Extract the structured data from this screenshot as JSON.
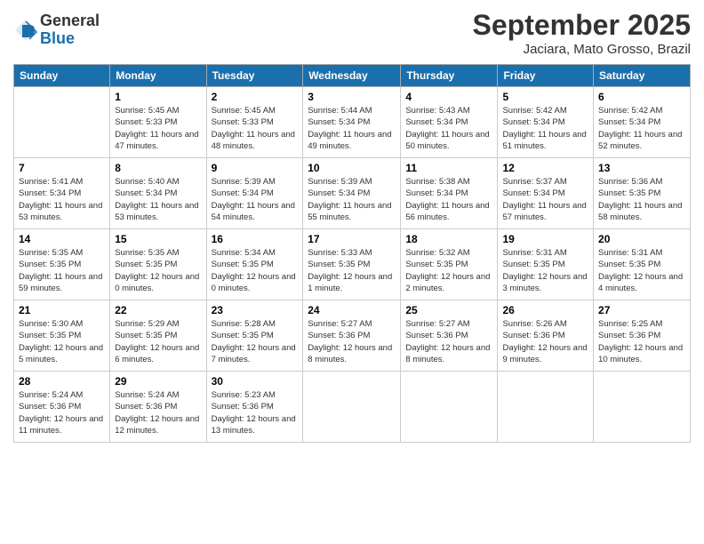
{
  "header": {
    "logo_general": "General",
    "logo_blue": "Blue",
    "month_title": "September 2025",
    "subtitle": "Jaciara, Mato Grosso, Brazil"
  },
  "days_of_week": [
    "Sunday",
    "Monday",
    "Tuesday",
    "Wednesday",
    "Thursday",
    "Friday",
    "Saturday"
  ],
  "weeks": [
    [
      {
        "day": "",
        "empty": true
      },
      {
        "day": "1",
        "sunrise": "Sunrise: 5:45 AM",
        "sunset": "Sunset: 5:33 PM",
        "daylight": "Daylight: 11 hours and 47 minutes."
      },
      {
        "day": "2",
        "sunrise": "Sunrise: 5:45 AM",
        "sunset": "Sunset: 5:33 PM",
        "daylight": "Daylight: 11 hours and 48 minutes."
      },
      {
        "day": "3",
        "sunrise": "Sunrise: 5:44 AM",
        "sunset": "Sunset: 5:34 PM",
        "daylight": "Daylight: 11 hours and 49 minutes."
      },
      {
        "day": "4",
        "sunrise": "Sunrise: 5:43 AM",
        "sunset": "Sunset: 5:34 PM",
        "daylight": "Daylight: 11 hours and 50 minutes."
      },
      {
        "day": "5",
        "sunrise": "Sunrise: 5:42 AM",
        "sunset": "Sunset: 5:34 PM",
        "daylight": "Daylight: 11 hours and 51 minutes."
      },
      {
        "day": "6",
        "sunrise": "Sunrise: 5:42 AM",
        "sunset": "Sunset: 5:34 PM",
        "daylight": "Daylight: 11 hours and 52 minutes."
      }
    ],
    [
      {
        "day": "7",
        "sunrise": "Sunrise: 5:41 AM",
        "sunset": "Sunset: 5:34 PM",
        "daylight": "Daylight: 11 hours and 53 minutes."
      },
      {
        "day": "8",
        "sunrise": "Sunrise: 5:40 AM",
        "sunset": "Sunset: 5:34 PM",
        "daylight": "Daylight: 11 hours and 53 minutes."
      },
      {
        "day": "9",
        "sunrise": "Sunrise: 5:39 AM",
        "sunset": "Sunset: 5:34 PM",
        "daylight": "Daylight: 11 hours and 54 minutes."
      },
      {
        "day": "10",
        "sunrise": "Sunrise: 5:39 AM",
        "sunset": "Sunset: 5:34 PM",
        "daylight": "Daylight: 11 hours and 55 minutes."
      },
      {
        "day": "11",
        "sunrise": "Sunrise: 5:38 AM",
        "sunset": "Sunset: 5:34 PM",
        "daylight": "Daylight: 11 hours and 56 minutes."
      },
      {
        "day": "12",
        "sunrise": "Sunrise: 5:37 AM",
        "sunset": "Sunset: 5:34 PM",
        "daylight": "Daylight: 11 hours and 57 minutes."
      },
      {
        "day": "13",
        "sunrise": "Sunrise: 5:36 AM",
        "sunset": "Sunset: 5:35 PM",
        "daylight": "Daylight: 11 hours and 58 minutes."
      }
    ],
    [
      {
        "day": "14",
        "sunrise": "Sunrise: 5:35 AM",
        "sunset": "Sunset: 5:35 PM",
        "daylight": "Daylight: 11 hours and 59 minutes."
      },
      {
        "day": "15",
        "sunrise": "Sunrise: 5:35 AM",
        "sunset": "Sunset: 5:35 PM",
        "daylight": "Daylight: 12 hours and 0 minutes."
      },
      {
        "day": "16",
        "sunrise": "Sunrise: 5:34 AM",
        "sunset": "Sunset: 5:35 PM",
        "daylight": "Daylight: 12 hours and 0 minutes."
      },
      {
        "day": "17",
        "sunrise": "Sunrise: 5:33 AM",
        "sunset": "Sunset: 5:35 PM",
        "daylight": "Daylight: 12 hours and 1 minute."
      },
      {
        "day": "18",
        "sunrise": "Sunrise: 5:32 AM",
        "sunset": "Sunset: 5:35 PM",
        "daylight": "Daylight: 12 hours and 2 minutes."
      },
      {
        "day": "19",
        "sunrise": "Sunrise: 5:31 AM",
        "sunset": "Sunset: 5:35 PM",
        "daylight": "Daylight: 12 hours and 3 minutes."
      },
      {
        "day": "20",
        "sunrise": "Sunrise: 5:31 AM",
        "sunset": "Sunset: 5:35 PM",
        "daylight": "Daylight: 12 hours and 4 minutes."
      }
    ],
    [
      {
        "day": "21",
        "sunrise": "Sunrise: 5:30 AM",
        "sunset": "Sunset: 5:35 PM",
        "daylight": "Daylight: 12 hours and 5 minutes."
      },
      {
        "day": "22",
        "sunrise": "Sunrise: 5:29 AM",
        "sunset": "Sunset: 5:35 PM",
        "daylight": "Daylight: 12 hours and 6 minutes."
      },
      {
        "day": "23",
        "sunrise": "Sunrise: 5:28 AM",
        "sunset": "Sunset: 5:35 PM",
        "daylight": "Daylight: 12 hours and 7 minutes."
      },
      {
        "day": "24",
        "sunrise": "Sunrise: 5:27 AM",
        "sunset": "Sunset: 5:36 PM",
        "daylight": "Daylight: 12 hours and 8 minutes."
      },
      {
        "day": "25",
        "sunrise": "Sunrise: 5:27 AM",
        "sunset": "Sunset: 5:36 PM",
        "daylight": "Daylight: 12 hours and 8 minutes."
      },
      {
        "day": "26",
        "sunrise": "Sunrise: 5:26 AM",
        "sunset": "Sunset: 5:36 PM",
        "daylight": "Daylight: 12 hours and 9 minutes."
      },
      {
        "day": "27",
        "sunrise": "Sunrise: 5:25 AM",
        "sunset": "Sunset: 5:36 PM",
        "daylight": "Daylight: 12 hours and 10 minutes."
      }
    ],
    [
      {
        "day": "28",
        "sunrise": "Sunrise: 5:24 AM",
        "sunset": "Sunset: 5:36 PM",
        "daylight": "Daylight: 12 hours and 11 minutes."
      },
      {
        "day": "29",
        "sunrise": "Sunrise: 5:24 AM",
        "sunset": "Sunset: 5:36 PM",
        "daylight": "Daylight: 12 hours and 12 minutes."
      },
      {
        "day": "30",
        "sunrise": "Sunrise: 5:23 AM",
        "sunset": "Sunset: 5:36 PM",
        "daylight": "Daylight: 12 hours and 13 minutes."
      },
      {
        "day": "",
        "empty": true
      },
      {
        "day": "",
        "empty": true
      },
      {
        "day": "",
        "empty": true
      },
      {
        "day": "",
        "empty": true
      }
    ]
  ]
}
